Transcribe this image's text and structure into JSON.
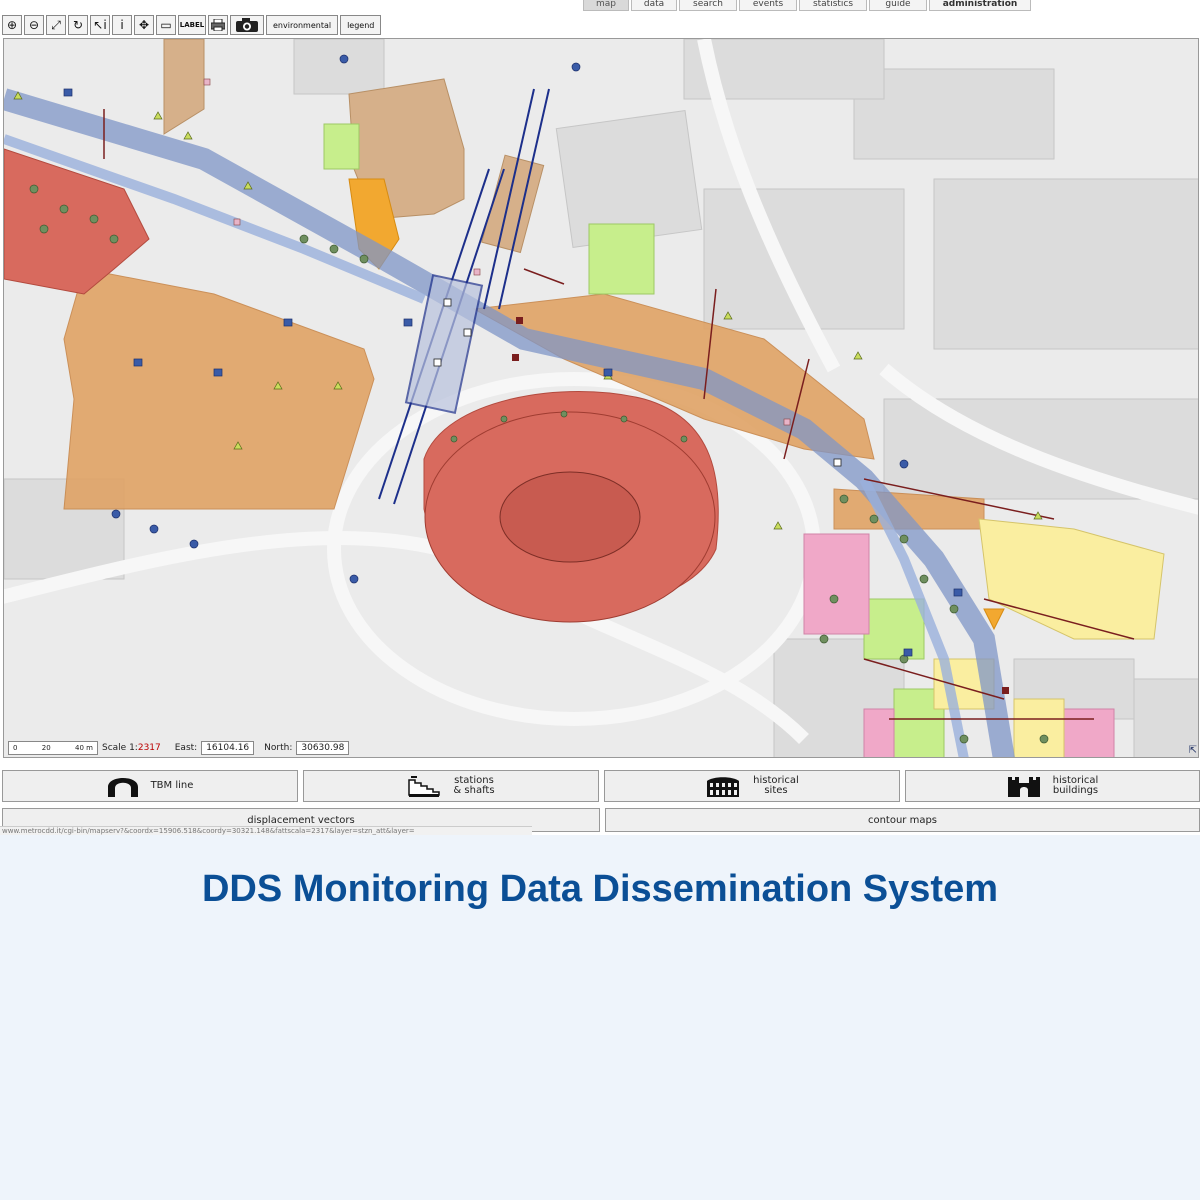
{
  "nav": {
    "tabs": [
      {
        "label": "map",
        "active": true
      },
      {
        "label": "data"
      },
      {
        "label": "search"
      },
      {
        "label": "events"
      },
      {
        "label": "statistics"
      },
      {
        "label": "guide"
      },
      {
        "label": "administration",
        "bold": true
      }
    ]
  },
  "toolbar": {
    "tools": [
      {
        "name": "zoom-in-icon",
        "glyph": "⊕"
      },
      {
        "name": "zoom-out-icon",
        "glyph": "⊖"
      },
      {
        "name": "zoom-box-icon",
        "glyph": "⤢"
      },
      {
        "name": "refresh-icon",
        "glyph": "↻"
      },
      {
        "name": "select-info-icon",
        "glyph": "↖i"
      },
      {
        "name": "info-icon",
        "glyph": "i"
      },
      {
        "name": "pan-icon",
        "glyph": "✥"
      },
      {
        "name": "measure-icon",
        "glyph": "▭"
      }
    ],
    "label_button": "LABEL",
    "environmental_label": "environmental",
    "legend_label": "legend"
  },
  "map": {
    "scale_ruler": [
      "0",
      "20",
      "40 m"
    ],
    "scale_label": "Scale 1:",
    "scale_value": "2317",
    "east_label": "East:",
    "east_value": "16104.16",
    "north_label": "North:",
    "north_value": "30630.98"
  },
  "layers": {
    "tbm_line": "TBM line",
    "stations_shafts_1": "stations",
    "stations_shafts_2": "& shafts",
    "historical_sites_1": "historical",
    "historical_sites_2": "sites",
    "historical_buildings_1": "historical",
    "historical_buildings_2": "buildings",
    "displacement_vectors": "displacement vectors",
    "contour_maps": "contour maps"
  },
  "statusbar": {
    "url": "www.metrocdd.it/cgi-bin/mapserv?&coordx=15906.518&coordy=30321.148&fattscala=2317&layer=stzn_att&layer="
  },
  "caption": "DDS Monitoring Data Dissemination System",
  "colors": {
    "caption": "#0b4f96",
    "monument_red": "#d86a5e",
    "archaeology_orange": "#e2a063",
    "building_tan": "#d8b48e",
    "tunnel_blue": "#7f95c7",
    "sensor_green": "#6f8f5f",
    "sensor_blue": "#3a5ba7"
  }
}
